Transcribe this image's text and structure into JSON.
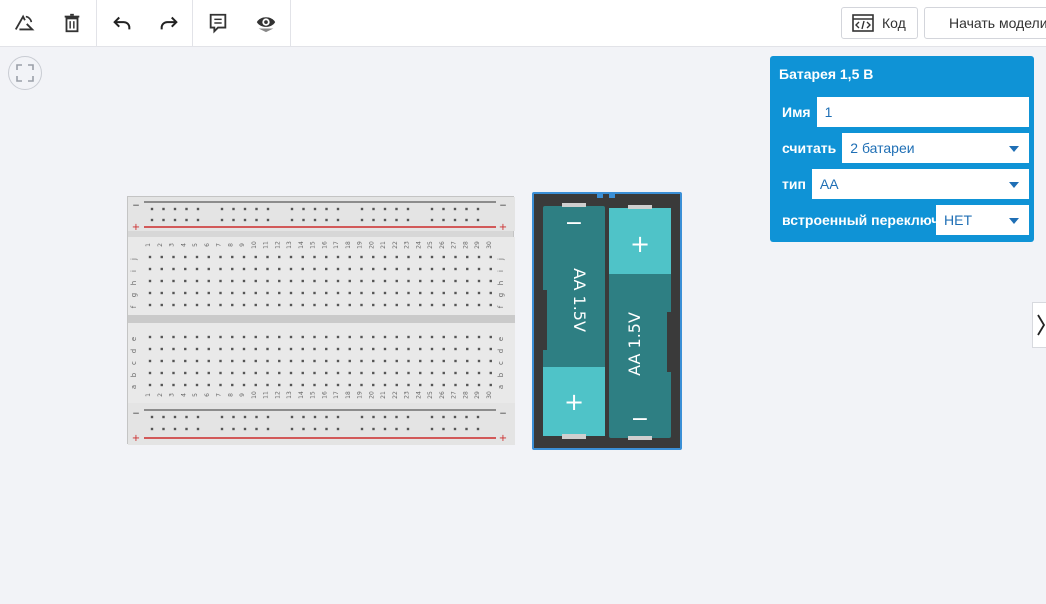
{
  "toolbar": {
    "icons": [
      "rotate-icon",
      "trash-icon",
      "undo-icon",
      "redo-icon",
      "notes-icon",
      "visibility-icon"
    ],
    "code_label": "Код",
    "start_label": "Начать моделирование"
  },
  "breadboard": {
    "column_numbers": [
      "1",
      "2",
      "3",
      "4",
      "5",
      "6",
      "7",
      "8",
      "9",
      "10",
      "11",
      "12",
      "13",
      "14",
      "15",
      "16",
      "17",
      "18",
      "19",
      "20",
      "21",
      "22",
      "23",
      "24",
      "25",
      "26",
      "27",
      "28",
      "29",
      "30"
    ],
    "rows_top": [
      "j",
      "i",
      "h",
      "g",
      "f"
    ],
    "rows_bottom": [
      "e",
      "d",
      "c",
      "b",
      "a"
    ],
    "rail_minus": "−",
    "rail_plus": "+"
  },
  "battery": {
    "cell_label": "AA 1.5V",
    "plus": "+",
    "minus": "−"
  },
  "inspector": {
    "title": "Батарея 1,5 В",
    "fields": [
      {
        "label": "Имя",
        "value": "1"
      },
      {
        "label": "считать",
        "value": "2 батареи"
      },
      {
        "label": "тип",
        "value": "AA"
      },
      {
        "label": "встроенный переключатель",
        "value": "НЕТ"
      }
    ]
  },
  "colors": {
    "accent": "#0f93d6",
    "battery_teal_dark": "#2e7f83",
    "battery_teal_light": "#4fc3c8",
    "rail_red": "#cc2b2b"
  }
}
